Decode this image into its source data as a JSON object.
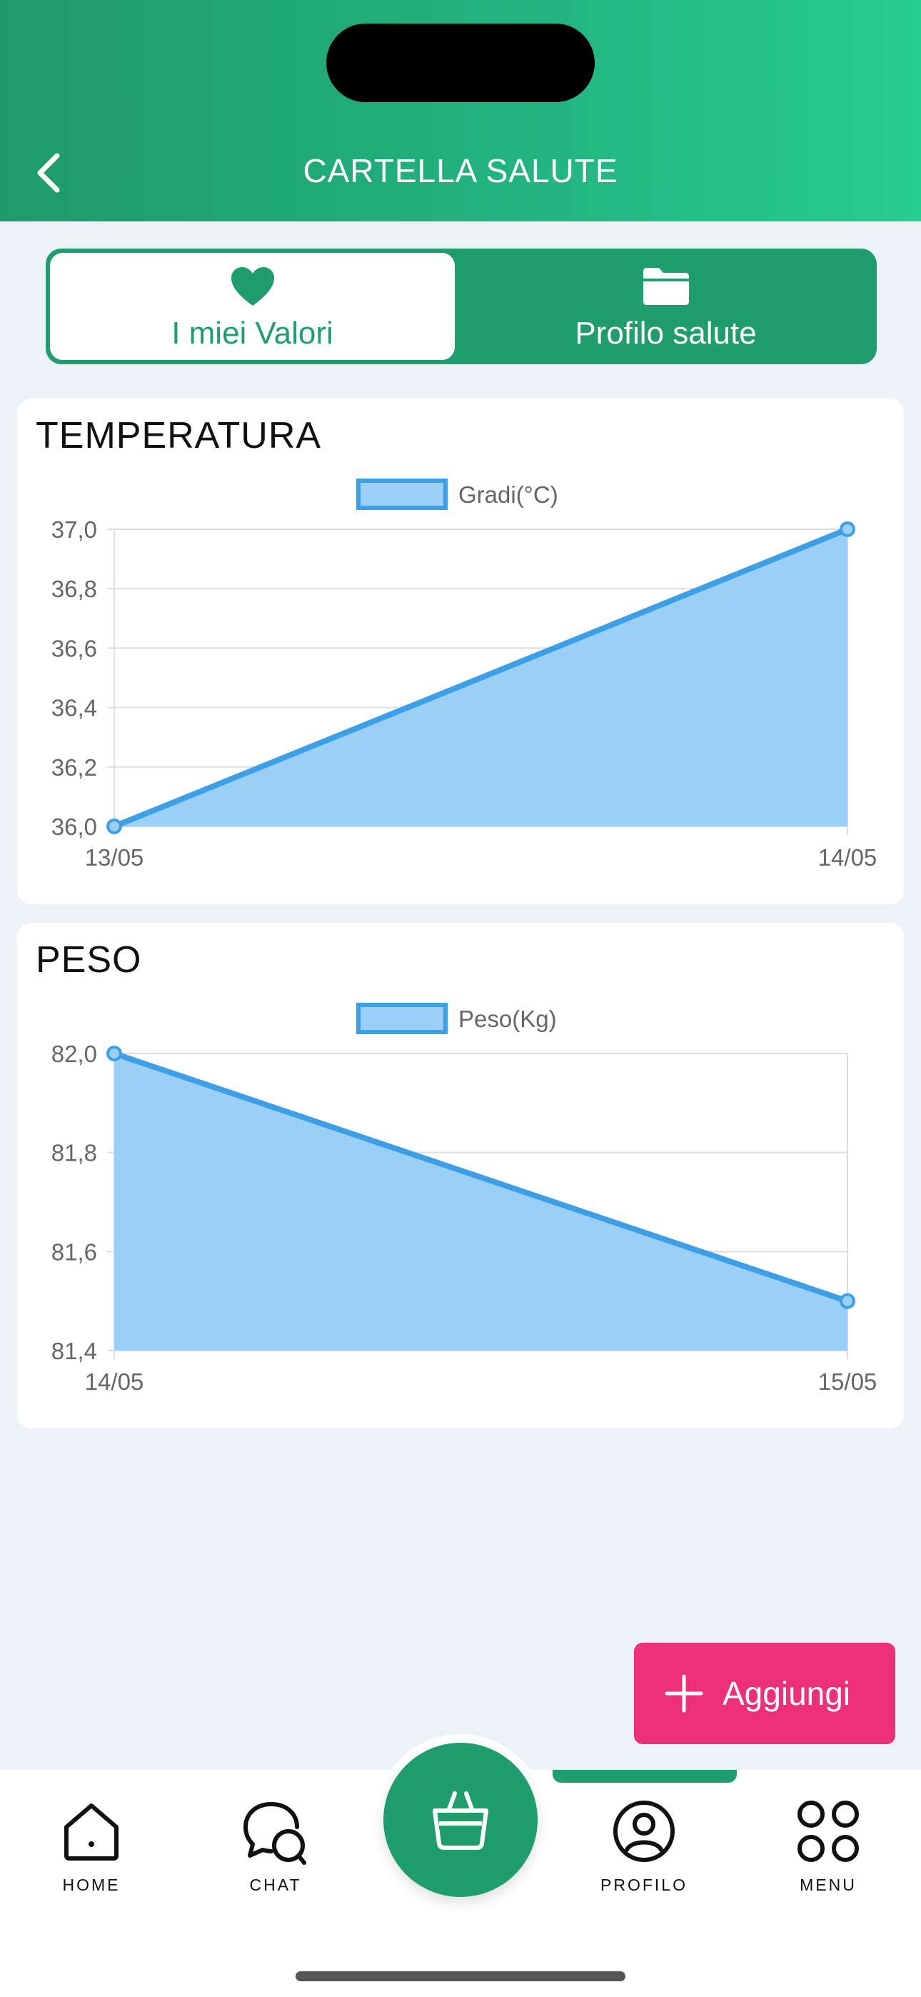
{
  "header": {
    "title": "CARTELLA SALUTE",
    "back_icon": "chevron-left-icon"
  },
  "tabs": [
    {
      "label": "I miei Valori",
      "icon": "heart-icon",
      "active": true
    },
    {
      "label": "Profilo salute",
      "icon": "folder-icon",
      "active": false
    }
  ],
  "cards": [
    {
      "title": "TEMPERATURA"
    },
    {
      "title": "PESO"
    }
  ],
  "chart_data": [
    {
      "type": "area",
      "title": "TEMPERATURA",
      "legend": "Gradi(°C)",
      "x": [
        "13/05",
        "14/05"
      ],
      "series": [
        {
          "name": "Gradi(°C)",
          "values": [
            36.0,
            37.0
          ]
        }
      ],
      "yticks": [
        "36,0",
        "36,2",
        "36,4",
        "36,6",
        "36,8",
        "37,0"
      ],
      "ylim": [
        36.0,
        37.0
      ],
      "color": "#3d9fe6",
      "fill": "#9ccff6",
      "grid": true,
      "legend_position": "top"
    },
    {
      "type": "area",
      "title": "PESO",
      "legend": "Peso(Kg)",
      "x": [
        "14/05",
        "15/05"
      ],
      "series": [
        {
          "name": "Peso(Kg)",
          "values": [
            82.0,
            81.5
          ]
        }
      ],
      "yticks": [
        "81,4",
        "81,6",
        "81,8",
        "82,0"
      ],
      "ylim": [
        81.4,
        82.0
      ],
      "color": "#3d9fe6",
      "fill": "#9ccff6",
      "grid": true,
      "legend_position": "top"
    }
  ],
  "add_button": {
    "label": "Aggiungi",
    "icon": "plus-icon"
  },
  "nav": [
    {
      "label": "HOME",
      "icon": "home-icon"
    },
    {
      "label": "CHAT",
      "icon": "chat-icon"
    },
    {
      "label": "",
      "icon": "shopping-bag-icon"
    },
    {
      "label": "PROFILO",
      "icon": "user-circle-icon",
      "active": true
    },
    {
      "label": "MENU",
      "icon": "grid-icon"
    }
  ],
  "colors": {
    "brand_green": "#1f9d6e",
    "accent_pink": "#ee2f7a",
    "background": "#edf2f9"
  }
}
